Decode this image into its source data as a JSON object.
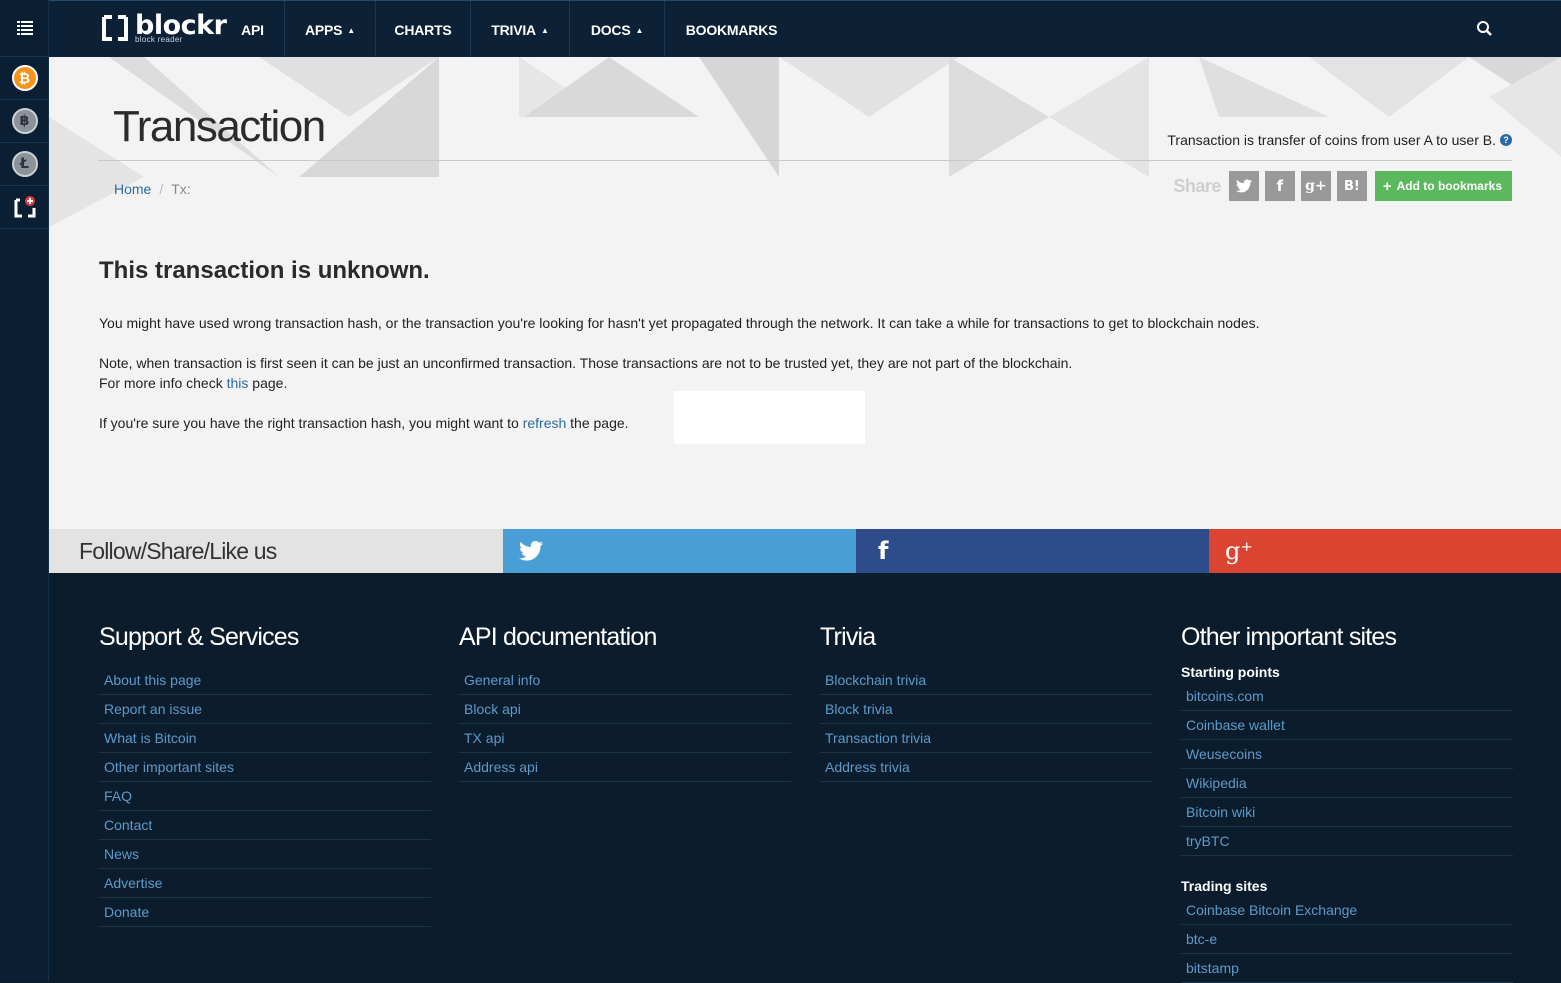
{
  "rail": {
    "items": [
      {
        "name": "menu",
        "icon": "list-menu-icon"
      },
      {
        "name": "bitcoin",
        "icon": "bitcoin-icon",
        "glyph": "₿"
      },
      {
        "name": "altcoin-1",
        "icon": "gear-coin-icon",
        "glyph": "฿"
      },
      {
        "name": "altcoin-2",
        "icon": "litecoin-icon",
        "glyph": "Ł"
      },
      {
        "name": "blockr-add",
        "icon": "blockr-add-icon"
      }
    ]
  },
  "nav": {
    "logo_word": "blockr",
    "logo_tag": "block reader",
    "items": [
      "API",
      "APPS",
      "CHARTS",
      "TRIVIA",
      "DOCS",
      "BOOKMARKS"
    ],
    "caret": "▲",
    "search_icon": "search-icon"
  },
  "hero": {
    "title": "Transaction",
    "description": "Transaction is transfer of coins from user A to user B.",
    "help": "?",
    "breadcrumb": {
      "home": "Home",
      "sep": "/",
      "current": "Tx:"
    },
    "share_label": "Share",
    "share_buttons": [
      "twitter",
      "f",
      "g+",
      "B!"
    ],
    "bookmark_plus": "+",
    "bookmark_label": "Add to bookmarks"
  },
  "content": {
    "heading": "This transaction is unknown.",
    "p1": "You might have used wrong transaction hash, or the transaction you're looking for hasn't yet propagated through the network. It can take a while for transactions to get to blockchain nodes.",
    "p2_line1": "Note, when transaction is first seen it can be just an unconfirmed transaction. Those transactions are not to be trusted yet, they are not part of the blockchain.",
    "p2_line2_pre": "For more info check ",
    "p2_link": "this",
    "p2_line2_post": " page.",
    "p3_pre": "If you're sure you have the right transaction hash, you might want to ",
    "p3_link": "refresh",
    "p3_post": " the page."
  },
  "follow": {
    "label": "Follow/Share/Like us",
    "facebook_glyph": "f",
    "gplus_glyph": "g⁺"
  },
  "footer": {
    "support": {
      "title": "Support & Services",
      "links": [
        "About this page",
        "Report an issue",
        "What is Bitcoin",
        "Other important sites",
        "FAQ",
        "Contact",
        "News",
        "Advertise",
        "Donate"
      ]
    },
    "api": {
      "title": "API documentation",
      "links": [
        "General info",
        "Block api",
        "TX api",
        "Address api"
      ]
    },
    "trivia": {
      "title": "Trivia",
      "links": [
        "Blockchain trivia",
        "Block trivia",
        "Transaction trivia",
        "Address trivia"
      ]
    },
    "other": {
      "title": "Other important sites",
      "starting_title": "Starting points",
      "starting_links": [
        "bitcoins.com",
        "Coinbase wallet",
        "Weusecoins",
        "Wikipedia",
        "Bitcoin wiki",
        "tryBTC"
      ],
      "trading_title": "Trading sites",
      "trading_links": [
        "Coinbase Bitcoin Exchange",
        "btc-e",
        "bitstamp"
      ]
    }
  },
  "colors": {
    "nav_bg": "#0c2036",
    "hero_bg": "#f3f3f3",
    "link": "#2a6aa5",
    "bookmark_green": "#5cb85c",
    "twitter": "#4a9ed6",
    "facebook": "#2f4c8a",
    "gplus": "#da4430",
    "footer_bg": "#0b1d2d"
  }
}
